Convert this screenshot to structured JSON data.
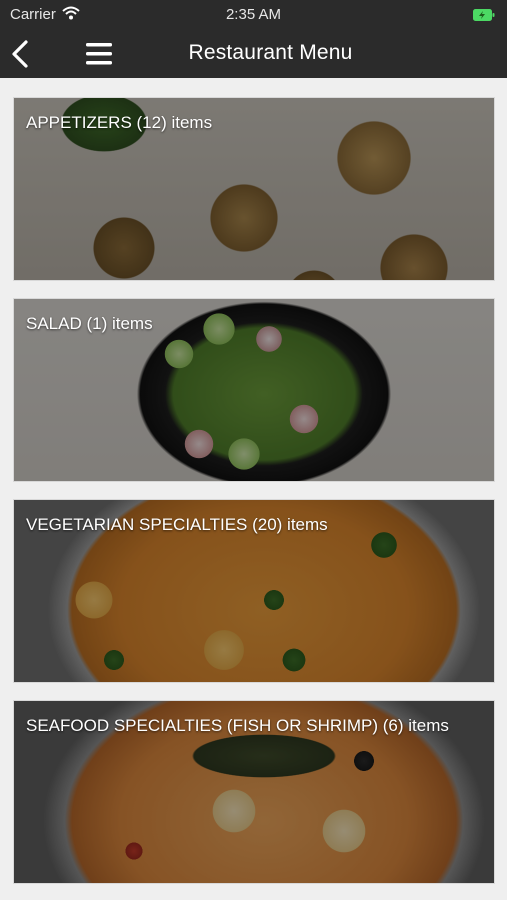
{
  "status_bar": {
    "carrier": "Carrier",
    "time": "2:35 AM",
    "battery_color": "#4cd964"
  },
  "nav_bar": {
    "title": "Restaurant Menu",
    "back_icon": "chevron-left-icon",
    "menu_icon": "hamburger-icon"
  },
  "categories": [
    {
      "label": "APPETIZERS (12) items"
    },
    {
      "label": "SALAD (1) items"
    },
    {
      "label": "VEGETARIAN SPECIALTIES (20) items"
    },
    {
      "label": "SEAFOOD SPECIALTIES (FISH OR SHRIMP) (6) items"
    }
  ]
}
